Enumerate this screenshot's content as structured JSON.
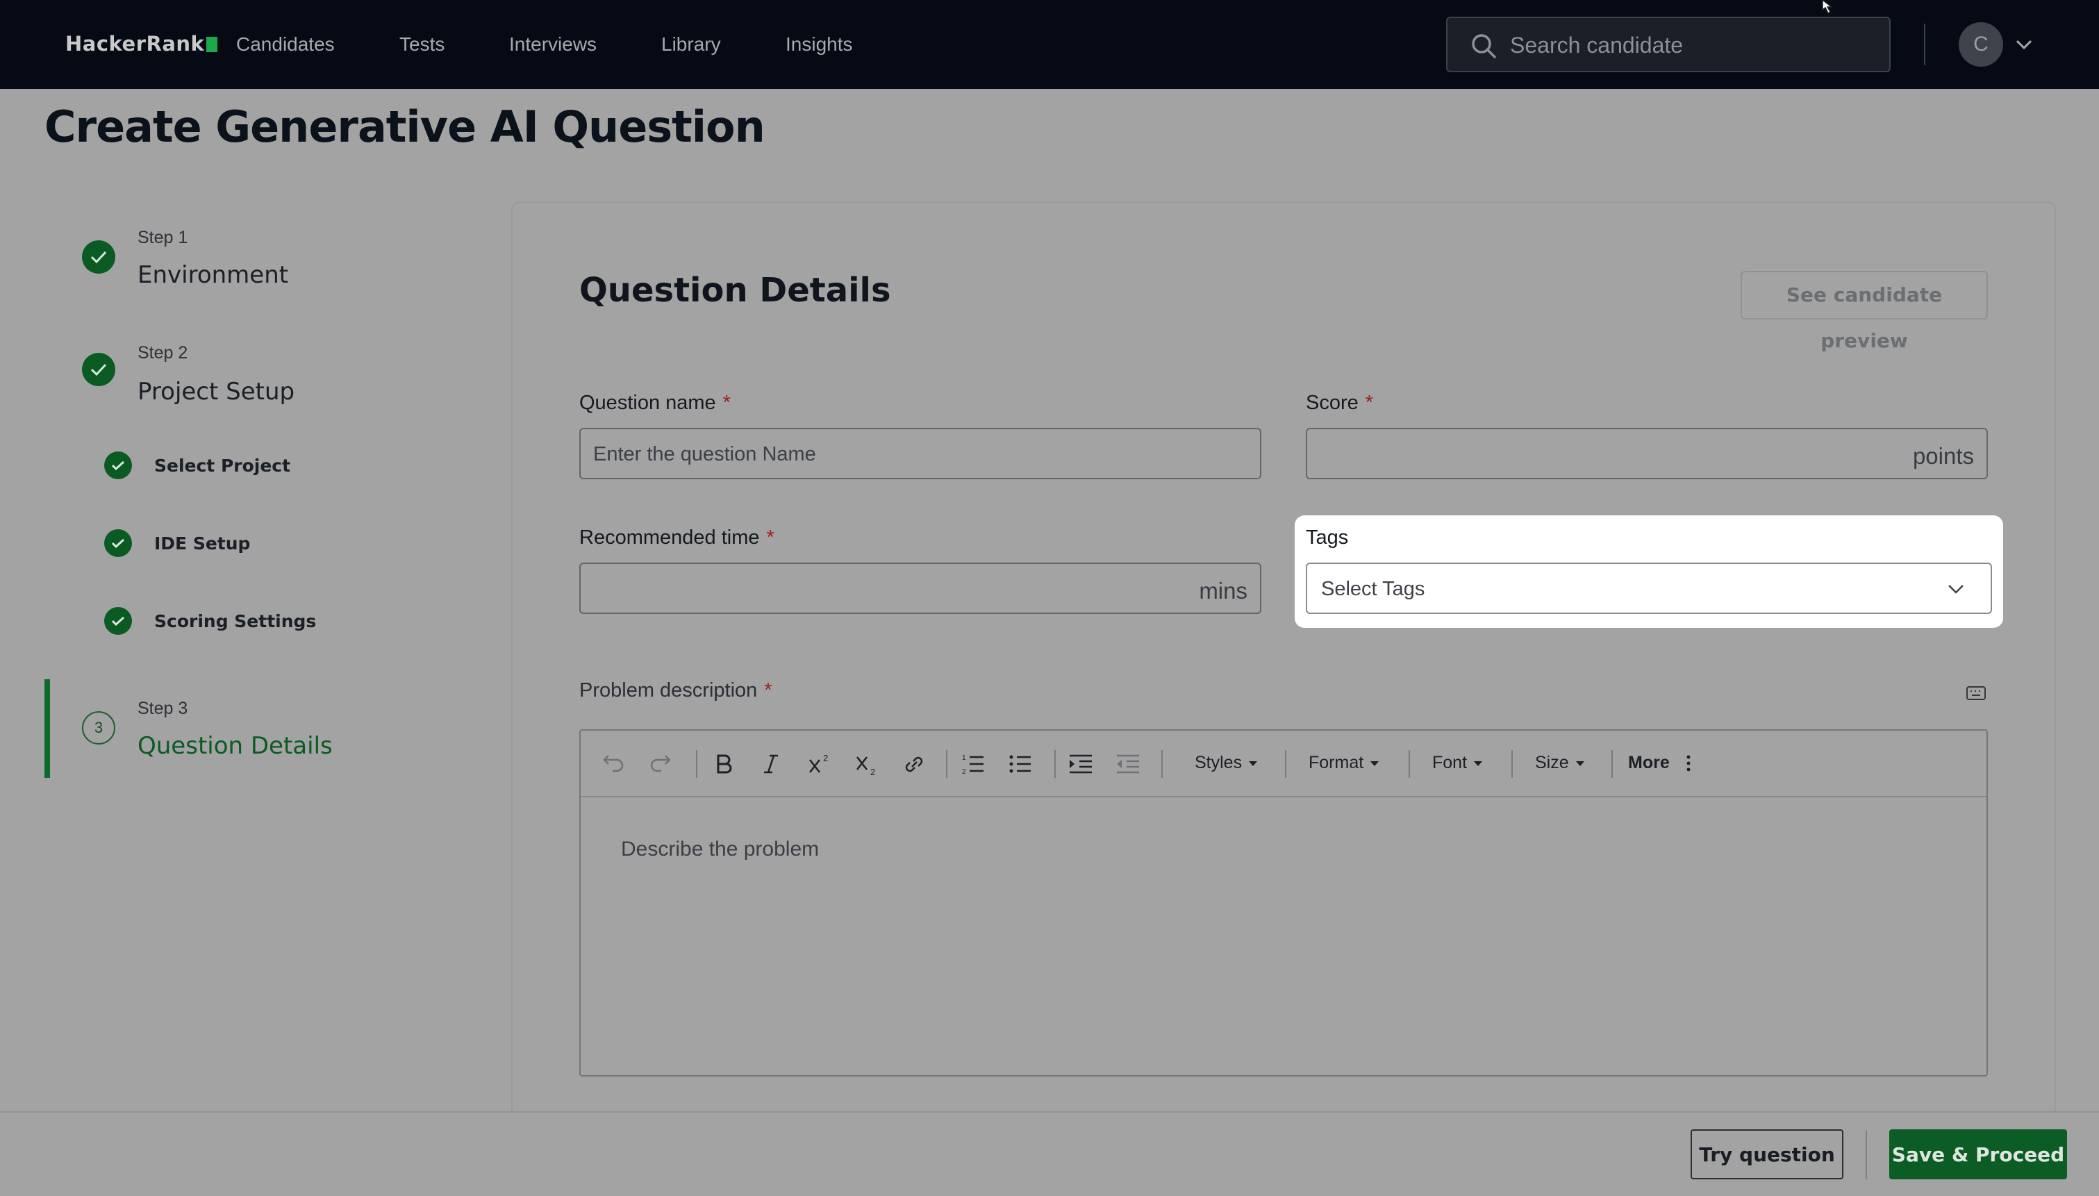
{
  "nav": {
    "logo": "HackerRank",
    "links": [
      "Candidates",
      "Tests",
      "Interviews",
      "Library",
      "Insights"
    ],
    "search_placeholder": "Search candidate",
    "avatar_initial": "C"
  },
  "page": {
    "title": "Create Generative AI Question"
  },
  "steps": {
    "step1": {
      "label": "Step 1",
      "title": "Environment",
      "status": "complete"
    },
    "step2": {
      "label": "Step 2",
      "title": "Project Setup",
      "status": "complete",
      "substeps": [
        "Select Project",
        "IDE Setup",
        "Scoring Settings"
      ]
    },
    "step3": {
      "label": "Step 3",
      "title": "Question Details",
      "number": "3",
      "status": "active"
    }
  },
  "form": {
    "section_title": "Question Details",
    "preview_button": "See candidate preview",
    "question_name": {
      "label": "Question name",
      "required": "*",
      "placeholder": "Enter the question Name"
    },
    "score": {
      "label": "Score",
      "required": "*",
      "suffix": "points"
    },
    "time": {
      "label": "Recommended time",
      "required": "*",
      "suffix": "mins"
    },
    "tags": {
      "label": "Tags",
      "placeholder": "Select Tags"
    },
    "description": {
      "label": "Problem description",
      "required": "*",
      "placeholder": "Describe the problem"
    }
  },
  "editor_toolbar": {
    "icons": [
      "undo-icon",
      "redo-icon",
      "bold-icon",
      "italic-icon",
      "superscript-icon",
      "subscript-icon",
      "link-icon",
      "numbered-list-icon",
      "bullet-list-icon",
      "indent-icon",
      "outdent-icon"
    ],
    "dropdowns": [
      "Styles",
      "Format",
      "Font",
      "Size"
    ],
    "more": "More"
  },
  "footer": {
    "try_button": "Try question",
    "save_button": "Save & Proceed"
  },
  "colors": {
    "brand_green": "#0c5d25",
    "nav_bg": "#050a14",
    "overlay": "#a3a3a3"
  }
}
